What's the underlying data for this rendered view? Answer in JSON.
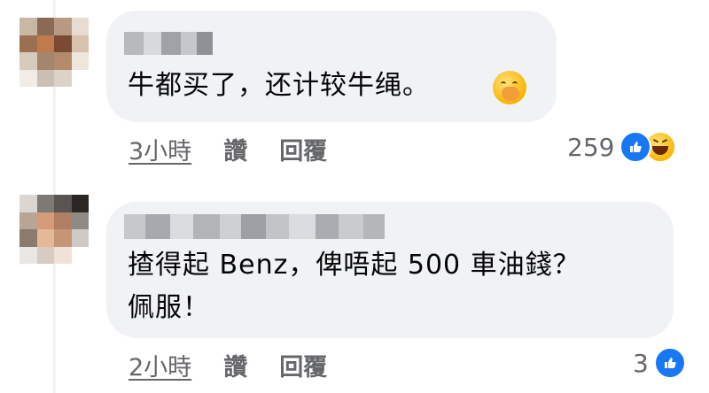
{
  "comments": [
    {
      "text_lines": [
        "牛都买了，还计较牛绳。"
      ],
      "emoji": "hand-over-mouth-emoji",
      "time": "3小時",
      "like_label": "讚",
      "reply_label": "回覆",
      "reaction_count": "259",
      "reactions": [
        "like-icon",
        "haha-icon"
      ]
    },
    {
      "text_lines": [
        "揸得起 Benz，俾唔起 500 車油錢？",
        "佩服！"
      ],
      "time": "2小時",
      "like_label": "讚",
      "reply_label": "回覆",
      "reaction_count": "3",
      "reactions": [
        "like-icon"
      ]
    }
  ],
  "colors": {
    "bubble": "#f0f2f5",
    "meta_text": "#65676b",
    "like_blue": "#1877f2",
    "haha_yellow": "#f7b500"
  }
}
